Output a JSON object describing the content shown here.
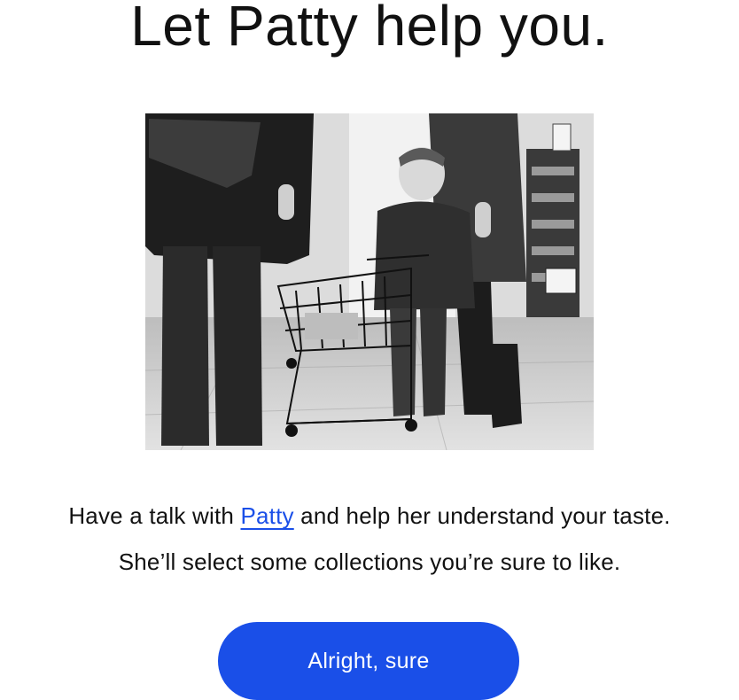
{
  "heading": "Let Patty help you.",
  "image": {
    "alt": "Black and white photo of a small child pushing a shopping cart in a store"
  },
  "intro": {
    "line1_before": "Have a talk with ",
    "link_label": "Patty",
    "line1_after": " and help her understand your taste.",
    "line2": "She’ll select some collections you’re sure to like."
  },
  "cta": {
    "label": "Alright, sure"
  },
  "colors": {
    "accent": "#1a4fe8",
    "text": "#111111",
    "background": "#ffffff"
  }
}
